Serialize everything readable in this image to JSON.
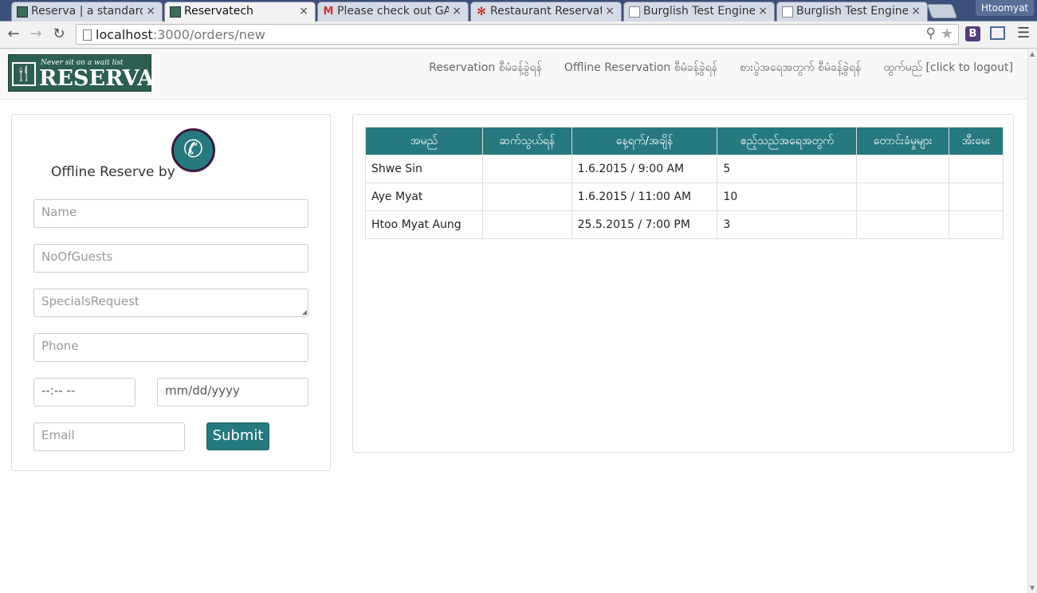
{
  "browser": {
    "tabs": [
      {
        "title": "Reserva | a standard",
        "icon": "restaurant-icon",
        "active": false
      },
      {
        "title": "Reservatech",
        "icon": "restaurant-icon",
        "active": true
      },
      {
        "title": "Please check out GA",
        "icon": "gmail-icon",
        "active": false
      },
      {
        "title": "Restaurant Reservat",
        "icon": "yelp-icon",
        "active": false
      },
      {
        "title": "Burglish Test Engine",
        "icon": "document-icon",
        "active": false
      },
      {
        "title": "Burglish Test Engine",
        "icon": "document-icon",
        "active": false
      }
    ],
    "profile_name": "Htoomyat",
    "url_host": "localhost",
    "url_path": ":3000/orders/new",
    "extension_label": "B"
  },
  "navbar": {
    "logo_tagline": "Never sit on a wait list",
    "logo_word": "RESERVA",
    "links": [
      "Reservation စီမံခန့်ခွဲရန်",
      "Offline Reservation စီမံခန့်ခွဲရန်",
      "စားပွဲအရေအတွက် စီမံခန့်ခွဲရန်",
      "ထွက်မည် [click to logout]"
    ]
  },
  "form": {
    "title": "Offline Reserve by",
    "name_placeholder": "Name",
    "guests_placeholder": "NoOfGuests",
    "specials_placeholder": "SpecialsRequest",
    "phone_placeholder": "Phone",
    "time_placeholder": "--:-- --",
    "date_placeholder": "mm/dd/yyyy",
    "email_placeholder": "Email",
    "submit_label": "Submit"
  },
  "table": {
    "headers": [
      "အမည်",
      "ဆက်သွယ်ရန်",
      "နေ့ရက်/အချိန်",
      "ဧည့်သည်အရေအတွက်",
      "တောင်းခံမှုများ",
      "အီးမေး"
    ],
    "rows": [
      [
        "Shwe Sin",
        "",
        "1.6.2015 / 9:00 AM",
        "5",
        "",
        ""
      ],
      [
        "Aye Myat",
        "",
        "1.6.2015 / 11:00 AM",
        "10",
        "",
        ""
      ],
      [
        "Htoo Myat Aung",
        "",
        "25.5.2015 / 7:00 PM",
        "3",
        "",
        ""
      ]
    ]
  },
  "colors": {
    "accent": "#277980",
    "logo_bg": "#2d5e52"
  }
}
